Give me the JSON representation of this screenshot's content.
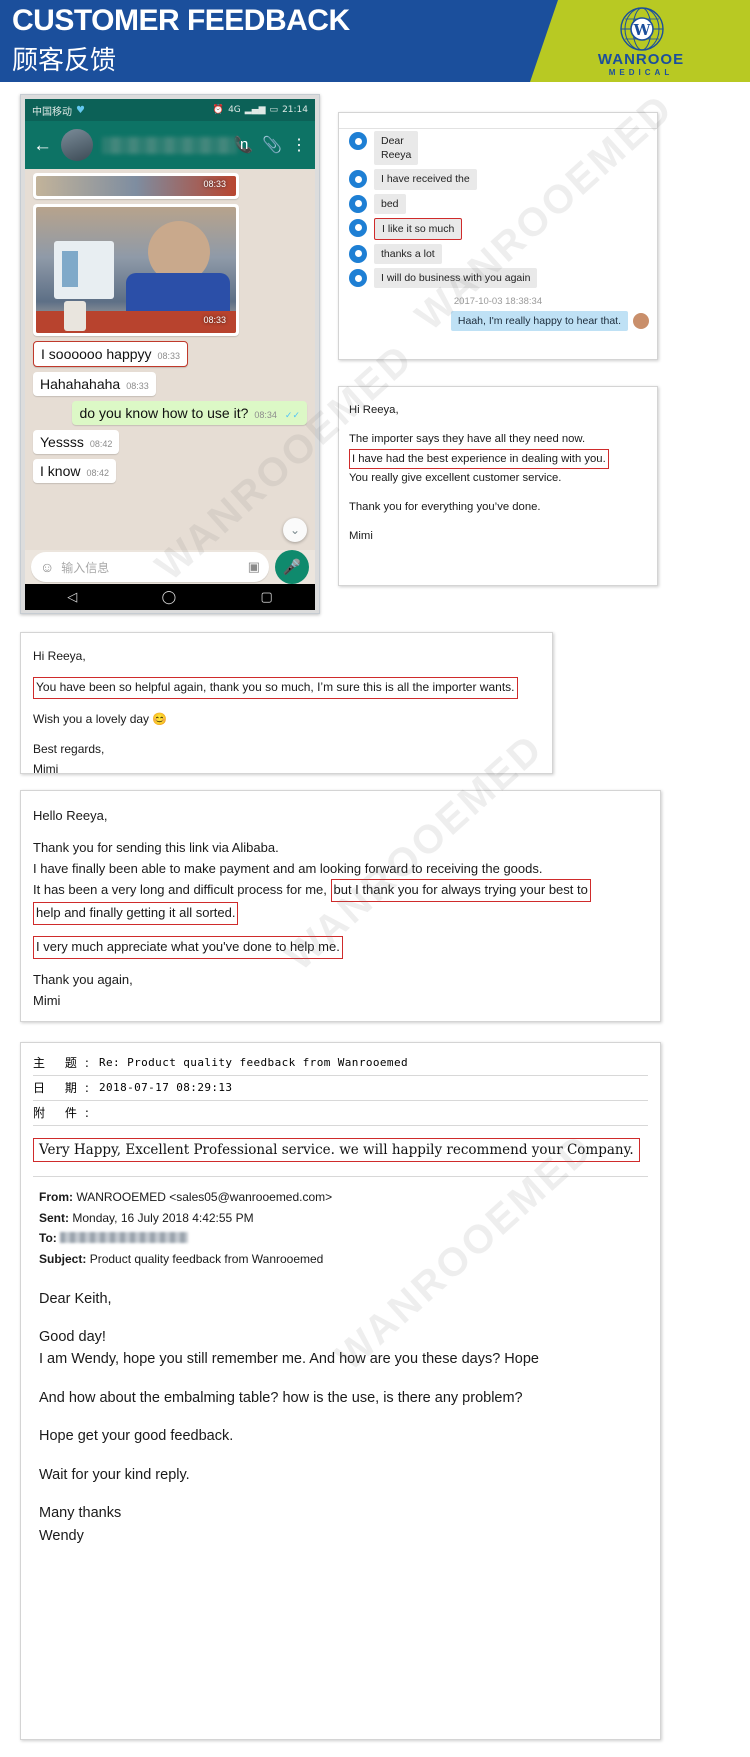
{
  "banner": {
    "title_en": "CUSTOMER FEEDBACK",
    "title_cn": "顾客反馈",
    "logo_letter": "W",
    "logo_name": "WANROOE",
    "logo_sub": "MEDICAL",
    "blue": "#1b4f9c",
    "green": "#b8c923"
  },
  "watermarks": [
    "WANROOEMED",
    "WANROOEMED",
    "WANROOEMED",
    "WANROOEMED"
  ],
  "phone": {
    "carrier": "中国移动",
    "network": "4G",
    "clock_icon": "alarm-icon",
    "time": "21:14",
    "contact_name_tail": "n",
    "call_icon": "phone-icon",
    "attach_icon": "paperclip-icon",
    "more_icon": "more-vertical-icon",
    "image_time_top": "08:33",
    "image_time": "08:33",
    "messages": [
      {
        "text": "I soooooo happyy",
        "time": "08:33",
        "side": "in",
        "highlight": true
      },
      {
        "text": "Hahahahaha",
        "time": "08:33",
        "side": "in",
        "highlight": false
      },
      {
        "text": "do you know how to use it?",
        "time": "08:34",
        "side": "out",
        "highlight": false
      },
      {
        "text": "Yessss",
        "time": "08:42",
        "side": "in",
        "highlight": false
      },
      {
        "text": "I know",
        "time": "08:42",
        "side": "in",
        "highlight": false
      }
    ],
    "input_placeholder": "输入信息",
    "emoji_icon": "smiley-icon",
    "camera_icon": "camera-icon",
    "mic_icon": "microphone-icon",
    "scroll_down_icon": "chevron-double-down-icon",
    "nav": {
      "back": "back-triangle-icon",
      "home": "home-circle-icon",
      "recents": "recents-square-icon"
    }
  },
  "alibaba_chat": {
    "messages": [
      {
        "text": "Dear\nReeya",
        "highlight": false
      },
      {
        "text": "I have received the",
        "highlight": false
      },
      {
        "text": "bed",
        "highlight": false
      },
      {
        "text": "I like it so much",
        "highlight": true
      },
      {
        "text": "thanks a lot",
        "highlight": false
      },
      {
        "text": "I will do business with you again",
        "highlight": false
      }
    ],
    "timestamp": "2017-10-03 18:38:34",
    "reply": "Haah, I'm really happy to hear that."
  },
  "letter1": {
    "greeting": "Hi Reeya,",
    "line1": "The importer says they have all they need now.",
    "line2_highlight": "I have had the best experience in dealing with you.",
    "line3": "You really give excellent customer service.",
    "line4": "Thank you for everything you’ve done.",
    "signature": "Mimi"
  },
  "letter2": {
    "greeting": "Hi Reeya,",
    "line1_highlight": "You have been so helpful again, thank you so much, I’m sure this is all the importer wants.",
    "line2": "Wish you a lovely day 😊",
    "signoff": "Best regards,",
    "signature": "Mimi"
  },
  "letter3": {
    "greeting": "Hello Reeya,",
    "line1": "Thank you for sending this link via Alibaba.",
    "line2": "I have finally been able to make payment and am looking forward to receiving the goods.",
    "line3_prefix": "It has been a very long and difficult process for me,",
    "line3_highlight": "but I thank you for always trying your best to",
    "line4_highlight": "help and finally getting it all sorted.",
    "line5_highlight": "I very much appreciate what you've done to help me.",
    "signoff": "Thank you again,",
    "signature": "Mimi"
  },
  "email": {
    "header_rows": [
      {
        "label": "主 题:",
        "value": "Re:  Product  quality  feedback  from  Wanrooemed"
      },
      {
        "label": "日 期:",
        "value": "2018-07-17 08:29:13"
      },
      {
        "label": "附 件:",
        "value": ""
      }
    ],
    "quote_highlight": "Very Happy, Excellent Professional service. we will happily recommend your Company.",
    "from_label": "From:",
    "from_value": "WANROOEMED <sales05@wanrooemed.com>",
    "sent_label": "Sent:",
    "sent_value": "Monday, 16 July 2018 4:42:55 PM",
    "to_label": "To:",
    "to_value": "",
    "subject_label": "Subject:",
    "subject_value": "Product quality feedback from Wanrooemed",
    "body": {
      "greeting": "Dear Keith,",
      "line1": "Good day!",
      "line2": "I am Wendy, hope you still remember me. And how are you these days? Hope",
      "line3": "And how about the embalming table? how is the use, is there any problem?",
      "line4": "Hope get your good feedback.",
      "line5": "Wait for your kind reply.",
      "signoff": "Many thanks",
      "signature": "Wendy"
    }
  }
}
